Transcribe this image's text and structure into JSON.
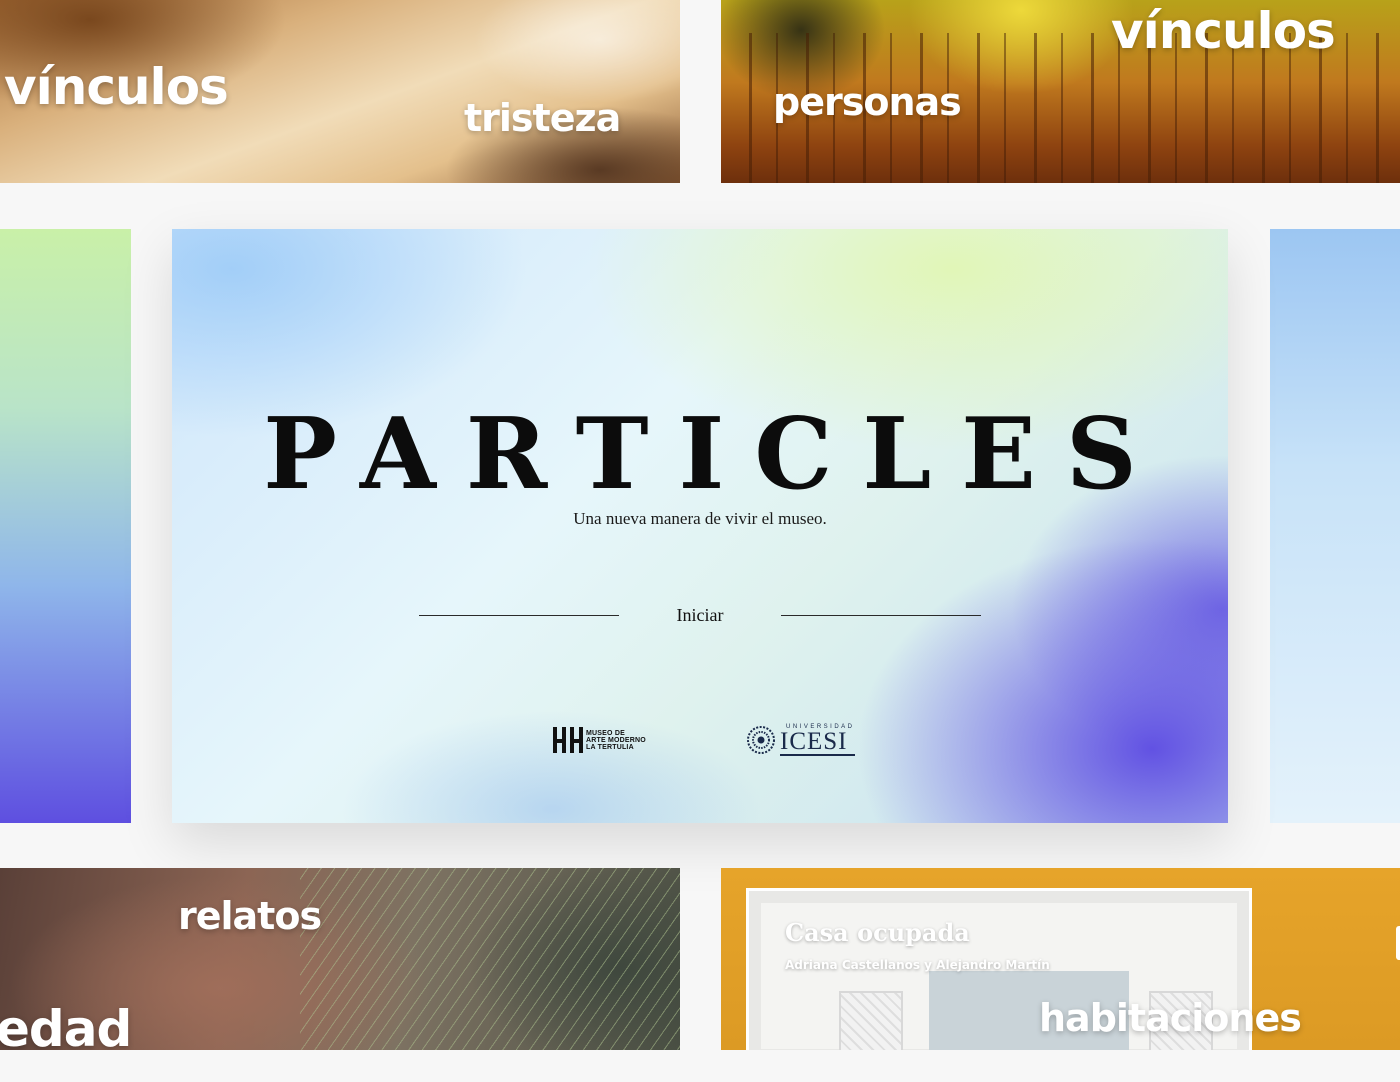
{
  "top_left_card": {
    "words": [
      "vínculos",
      "tristeza"
    ]
  },
  "top_right_card": {
    "words": [
      "vínculos",
      "personas"
    ]
  },
  "hero": {
    "title": "PARTICLES",
    "subtitle": "Una nueva manera de vivir el museo.",
    "start_label": "Iniciar",
    "logos": {
      "museum": [
        "MUSEO DE",
        "ARTE MODERNO",
        "LA TERTULIA"
      ],
      "university_small": "UNIVERSIDAD",
      "university_big": "ICESI"
    }
  },
  "bottom_left_card": {
    "words": [
      "relatos",
      "edad"
    ]
  },
  "bottom_right_card": {
    "title": "Casa ocupada",
    "authors": "Adriana Castellanos y Alejandro Martín",
    "word": "habitaciones"
  },
  "colors": {
    "background": "#f7f7f7",
    "hero_blue": "#5c4ae2",
    "hero_green": "#e1f6b4",
    "house_wall": "#e6a42a"
  }
}
